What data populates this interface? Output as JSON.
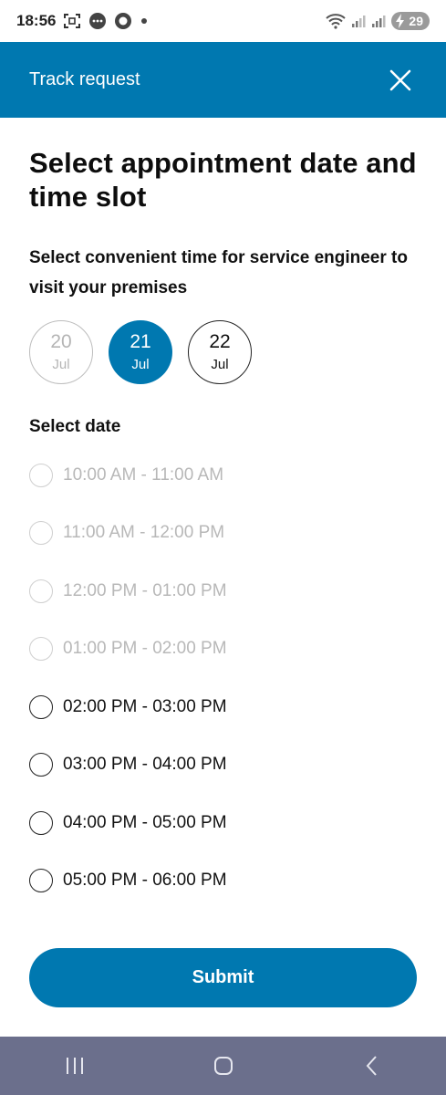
{
  "status_bar": {
    "time": "18:56",
    "battery": "29",
    "icons": [
      "screenshot-icon",
      "chat-bubble-icon",
      "record-icon",
      "dot-icon",
      "wifi-icon",
      "signal-icon",
      "signal-icon",
      "battery-charging-icon"
    ]
  },
  "header": {
    "title": "Track request",
    "close_icon": "close-icon"
  },
  "page": {
    "title": "Select appointment date and time slot",
    "subtitle": "Select convenient time for service engineer to visit your premises"
  },
  "dates": [
    {
      "day": "20",
      "month": "Jul",
      "state": "disabled"
    },
    {
      "day": "21",
      "month": "Jul",
      "state": "selected"
    },
    {
      "day": "22",
      "month": "Jul",
      "state": "available"
    }
  ],
  "slots_label": "Select date",
  "time_slots": [
    {
      "label": "10:00 AM - 11:00 AM",
      "enabled": false
    },
    {
      "label": "11:00 AM - 12:00 PM",
      "enabled": false
    },
    {
      "label": "12:00 PM - 01:00 PM",
      "enabled": false
    },
    {
      "label": "01:00 PM - 02:00 PM",
      "enabled": false
    },
    {
      "label": "02:00 PM - 03:00 PM",
      "enabled": true
    },
    {
      "label": "03:00 PM - 04:00 PM",
      "enabled": true
    },
    {
      "label": "04:00 PM - 05:00 PM",
      "enabled": true
    },
    {
      "label": "05:00 PM - 06:00 PM",
      "enabled": true
    },
    {
      "label": "",
      "enabled": true
    }
  ],
  "submit_label": "Submit",
  "colors": {
    "primary": "#0078b0",
    "nav_bar": "#6b6f8c",
    "disabled": "#b8b8b8"
  },
  "nav_icons": [
    "recent-apps-icon",
    "home-icon",
    "back-icon"
  ]
}
